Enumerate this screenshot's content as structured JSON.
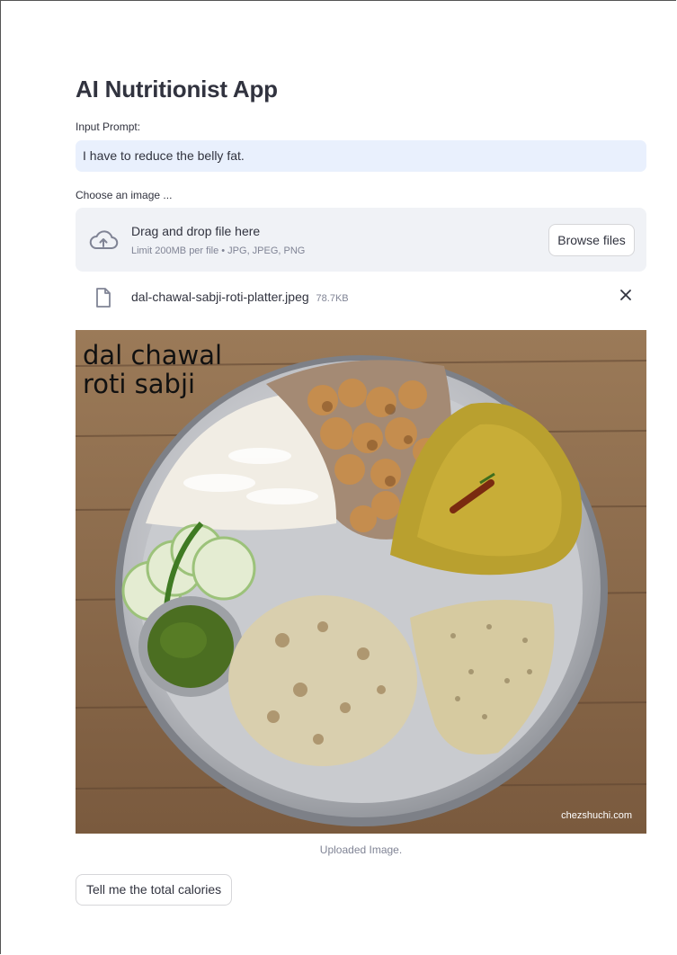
{
  "app": {
    "title": "AI Nutritionist App"
  },
  "prompt": {
    "label": "Input Prompt:",
    "value": "I have to reduce the belly fat."
  },
  "uploader": {
    "label": "Choose an image ...",
    "drop_text": "Drag and drop file here",
    "limit_text": "Limit 200MB per file • JPG, JPEG, PNG",
    "browse_label": "Browse files",
    "icon": "cloud-upload-icon"
  },
  "file": {
    "name": "dal-chawal-sabji-roti-platter.jpeg",
    "size": "78.7KB",
    "icon": "file-icon",
    "remove_icon": "close-icon"
  },
  "image": {
    "overlay_text_line1": "dal chawal",
    "overlay_text_line2": "roti sabji",
    "watermark": "chezshuchi.com",
    "caption": "Uploaded Image."
  },
  "action": {
    "button_label": "Tell me the total calories"
  },
  "colors": {
    "input_bg": "#e9f0fd",
    "dropzone_bg": "#f0f2f6",
    "text": "#31333f",
    "muted": "#808495"
  }
}
